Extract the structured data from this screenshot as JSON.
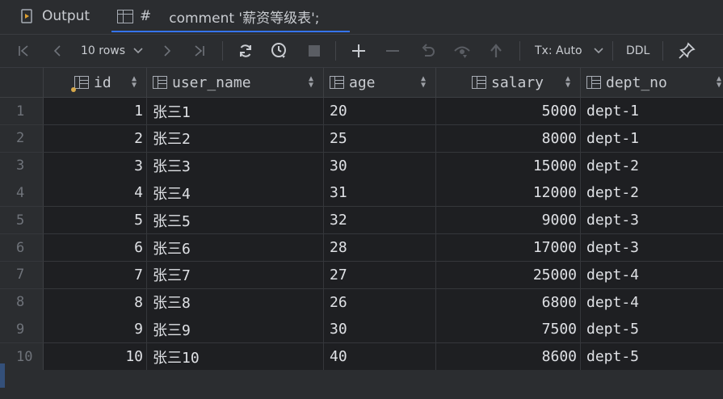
{
  "tabs": {
    "output_label": "Output",
    "result_hash": "#",
    "result_label": "comment '薪资等级表';"
  },
  "toolbar": {
    "rows_label": "10 rows",
    "tx_label": "Tx: Auto",
    "ddl_label": "DDL",
    "icons": [
      "first-page-icon",
      "prev-page-icon",
      "next-page-icon",
      "last-page-icon",
      "refresh-icon",
      "history-icon",
      "stop-icon",
      "add-row-icon",
      "delete-row-icon",
      "revert-icon",
      "preview-icon",
      "submit-icon",
      "pin-icon"
    ]
  },
  "columns": [
    {
      "name": "id",
      "align": "right"
    },
    {
      "name": "user_name",
      "align": "left"
    },
    {
      "name": "age",
      "align": "left"
    },
    {
      "name": "salary",
      "align": "right"
    },
    {
      "name": "dept_no",
      "align": "left"
    }
  ],
  "rows": [
    {
      "rn": "1",
      "id": "1",
      "user_name": "张三1",
      "age": "20",
      "salary": "5000",
      "dept_no": "dept-1"
    },
    {
      "rn": "2",
      "id": "2",
      "user_name": "张三2",
      "age": "25",
      "salary": "8000",
      "dept_no": "dept-1"
    },
    {
      "rn": "3",
      "id": "3",
      "user_name": "张三3",
      "age": "30",
      "salary": "15000",
      "dept_no": "dept-2"
    },
    {
      "rn": "4",
      "id": "4",
      "user_name": "张三4",
      "age": "31",
      "salary": "12000",
      "dept_no": "dept-2"
    },
    {
      "rn": "5",
      "id": "5",
      "user_name": "张三5",
      "age": "32",
      "salary": "9000",
      "dept_no": "dept-3"
    },
    {
      "rn": "6",
      "id": "6",
      "user_name": "张三6",
      "age": "28",
      "salary": "17000",
      "dept_no": "dept-3"
    },
    {
      "rn": "7",
      "id": "7",
      "user_name": "张三7",
      "age": "27",
      "salary": "25000",
      "dept_no": "dept-4"
    },
    {
      "rn": "8",
      "id": "8",
      "user_name": "张三8",
      "age": "26",
      "salary": "6800",
      "dept_no": "dept-4"
    },
    {
      "rn": "9",
      "id": "9",
      "user_name": "张三9",
      "age": "30",
      "salary": "7500",
      "dept_no": "dept-5"
    },
    {
      "rn": "10",
      "id": "10",
      "user_name": "张三10",
      "age": "40",
      "salary": "8600",
      "dept_no": "dept-5"
    }
  ],
  "colors": {
    "accent": "#3574f0",
    "background": "#1e1f22",
    "header": "#2b2d30"
  }
}
